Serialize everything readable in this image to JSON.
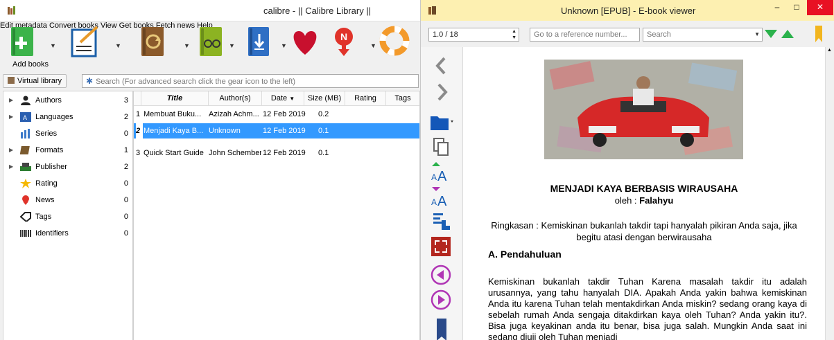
{
  "calibre": {
    "title": "calibre - || Calibre Library ||",
    "toolbar": [
      {
        "label": "Add books",
        "icon": "add-books-icon"
      },
      {
        "label": "Edit metadata",
        "icon": "edit-metadata-icon"
      },
      {
        "label": "Convert books",
        "icon": "convert-books-icon"
      },
      {
        "label": "View",
        "icon": "view-icon"
      },
      {
        "label": "Get books",
        "icon": "get-books-icon"
      },
      {
        "label": "",
        "icon": "heart-icon"
      },
      {
        "label": "Fetch news",
        "icon": "fetch-news-icon"
      },
      {
        "label": "Help",
        "icon": "help-icon"
      }
    ],
    "virtual_library": "Virtual library",
    "search_placeholder": "Search (For advanced search click the gear icon to the left)",
    "tags": [
      {
        "name": "Authors",
        "count": "3",
        "icon": "authors-icon"
      },
      {
        "name": "Languages",
        "count": "2",
        "icon": "languages-icon"
      },
      {
        "name": "Series",
        "count": "0",
        "icon": "series-icon"
      },
      {
        "name": "Formats",
        "count": "1",
        "icon": "formats-icon"
      },
      {
        "name": "Publisher",
        "count": "2",
        "icon": "publisher-icon"
      },
      {
        "name": "Rating",
        "count": "0",
        "icon": "rating-icon"
      },
      {
        "name": "News",
        "count": "0",
        "icon": "news-icon"
      },
      {
        "name": "Tags",
        "count": "0",
        "icon": "tags-icon"
      },
      {
        "name": "Identifiers",
        "count": "0",
        "icon": "identifiers-icon"
      }
    ],
    "columns": [
      "Title",
      "Author(s)",
      "Date",
      "Size (MB)",
      "Rating",
      "Tags"
    ],
    "books": [
      {
        "num": "1",
        "title": "Membuat Buku...",
        "author": "Azizah Achm...",
        "date": "12 Feb 2019",
        "size": "0.2"
      },
      {
        "num": "2",
        "title": "Menjadi Kaya B...",
        "author": "Unknown",
        "date": "12 Feb 2019",
        "size": "0.1"
      },
      {
        "num": "3",
        "title": "Quick Start Guide",
        "author": "John Schember",
        "date": "12 Feb 2019",
        "size": "0.1"
      }
    ]
  },
  "viewer": {
    "title": "Unknown [EPUB] - E-book viewer",
    "page_indicator": "1.0 / 18",
    "goto_placeholder": "Go to a reference number...",
    "search_placeholder": "Search",
    "book_title": "MENJADI KAYA BERBASIS WIRAUSAHA",
    "byline_prefix": "oleh : ",
    "author": "Falahyu",
    "summary": "Ringkasan : Kemiskinan bukanlah takdir tapi hanyalah pikiran Anda saja, jika begitu atasi dengan berwirausaha",
    "section_heading": "A. Pendahuluan",
    "body_text": "Kemiskinan bukanlah takdir Tuhan Karena masalah takdir itu adalah urusannya, yang tahu hanyalah DIA. Apakah Anda yakin bahwa kemiskinan Anda itu karena Tuhan telah mentakdirkan Anda miskin? sedang orang kaya di sebelah rumah Anda sengaja ditakdirkan kaya oleh Tuhan? Anda yakin itu?. Bisa juga keyakinan anda itu benar, bisa juga salah. Mungkin Anda saat ini sedang diuji oleh Tuhan menjadi"
  },
  "colors": {
    "selection": "#3399ff",
    "viewer_titlebar": "#fdf0b1",
    "close": "#e81123"
  }
}
